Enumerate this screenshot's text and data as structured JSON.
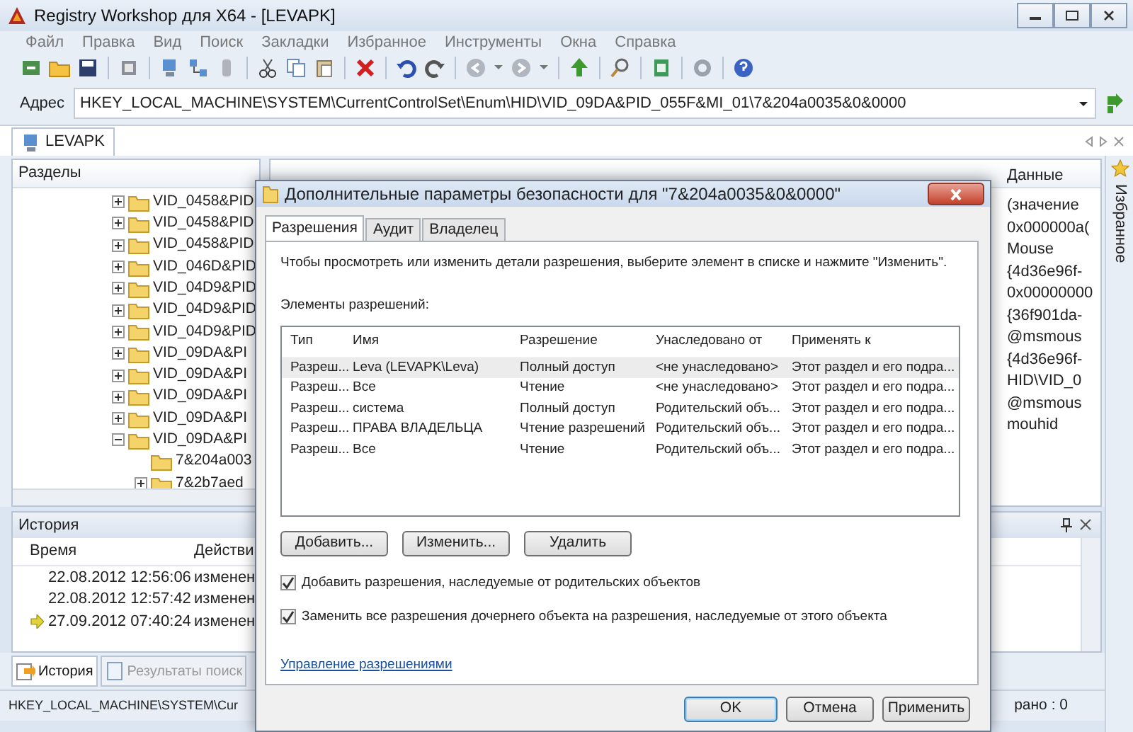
{
  "window": {
    "title": "Registry Workshop для X64 - [LEVAPK]"
  },
  "menu": [
    "Файл",
    "Правка",
    "Вид",
    "Поиск",
    "Закладки",
    "Избранное",
    "Инструменты",
    "Окна",
    "Справка"
  ],
  "address": {
    "label": "Адрес",
    "value": "HKEY_LOCAL_MACHINE\\SYSTEM\\CurrentControlSet\\Enum\\HID\\VID_09DA&PID_055F&MI_01\\7&204a0035&0&0000"
  },
  "document_tabs": [
    {
      "label": "LEVAPK",
      "selected": true
    }
  ],
  "keys_pane": {
    "header": "Разделы",
    "tree": [
      {
        "label": "VID_0458&PID",
        "expanded": false
      },
      {
        "label": "VID_0458&PID",
        "expanded": false
      },
      {
        "label": "VID_0458&PID",
        "expanded": false
      },
      {
        "label": "VID_046D&PID",
        "expanded": false
      },
      {
        "label": "VID_04D9&PID",
        "expanded": false
      },
      {
        "label": "VID_04D9&PID",
        "expanded": false
      },
      {
        "label": "VID_04D9&PID",
        "expanded": false
      },
      {
        "label": "VID_09DA&PI",
        "expanded": false
      },
      {
        "label": "VID_09DA&PI",
        "expanded": false
      },
      {
        "label": "VID_09DA&PI",
        "expanded": false
      },
      {
        "label": "VID_09DA&PI",
        "expanded": false
      },
      {
        "label": "VID_09DA&PI",
        "expanded": true,
        "children": [
          {
            "label": "7&204a003"
          },
          {
            "label": "7&2b7aed",
            "expanded": false
          }
        ]
      }
    ]
  },
  "values_pane": {
    "column_header": "Данные",
    "values": [
      "(значение",
      "0x000000a(",
      "Mouse",
      "{4d36e96f-",
      "0x00000000",
      "{36f901da-",
      "@msmous",
      "{4d36e96f-",
      "HID\\VID_0",
      "@msmous",
      "mouhid"
    ]
  },
  "favorites_sidebar": {
    "label": "Избранное"
  },
  "history": {
    "title": "История",
    "columns": [
      "Время",
      "Действи"
    ],
    "rows": [
      {
        "time": "22.08.2012 12:56:06",
        "action": "изменен",
        "current": false
      },
      {
        "time": "22.08.2012 12:57:42",
        "action": "изменен",
        "current": false
      },
      {
        "time": "27.09.2012 07:40:24",
        "action": "изменен",
        "current": true
      }
    ]
  },
  "bottom_tabs": [
    {
      "label": "История",
      "selected": true
    },
    {
      "label": "Результаты поиск",
      "selected": false
    }
  ],
  "status_bar": {
    "path": "HKEY_LOCAL_MACHINE\\SYSTEM\\Cur",
    "count": "рано : 0"
  },
  "dialog": {
    "title": "Дополнительные параметры безопасности  для \"7&204a0035&0&0000\"",
    "tabs": [
      {
        "label": "Разрешения",
        "selected": true
      },
      {
        "label": "Аудит",
        "selected": false
      },
      {
        "label": "Владелец",
        "selected": false
      }
    ],
    "instruction": "Чтобы просмотреть или изменить детали разрешения, выберите элемент в списке и нажмите \"Изменить\".",
    "list_label": "Элементы разрешений:",
    "columns": [
      "Тип",
      "Имя",
      "Разрешение",
      "Унаследовано от",
      "Применять к"
    ],
    "rows": [
      {
        "cells": [
          "Разреш...",
          "Leva (LEVAPK\\Leva)",
          "Полный доступ",
          "<не унаследовано>",
          "Этот раздел и его подра..."
        ],
        "selected": true
      },
      {
        "cells": [
          "Разреш...",
          "Все",
          "Чтение",
          "<не унаследовано>",
          "Этот раздел и его подра..."
        ],
        "selected": false
      },
      {
        "cells": [
          "Разреш...",
          "система",
          "Полный доступ",
          "Родительский объ...",
          "Этот раздел и его подра..."
        ],
        "selected": false
      },
      {
        "cells": [
          "Разреш...",
          "ПРАВА ВЛАДЕЛЬЦА",
          "Чтение разрешений",
          "Родительский объ...",
          "Этот раздел и его подра..."
        ],
        "selected": false
      },
      {
        "cells": [
          "Разреш...",
          "Все",
          "Чтение",
          "Родительский объ...",
          "Этот раздел и его подра..."
        ],
        "selected": false
      }
    ],
    "list_buttons": [
      "Добавить...",
      "Изменить...",
      "Удалить"
    ],
    "options": [
      {
        "label": "Добавить разрешения, наследуемые от родительских объектов",
        "checked": true
      },
      {
        "label": "Заменить все разрешения дочернего объекта на разрешения, наследуемые от этого объекта",
        "checked": true
      }
    ],
    "link": "Управление разрешениями",
    "footer_buttons": [
      {
        "label": "OK",
        "default": true
      },
      {
        "label": "Отмена",
        "default": false
      },
      {
        "label": "Применить",
        "default": false
      }
    ]
  }
}
